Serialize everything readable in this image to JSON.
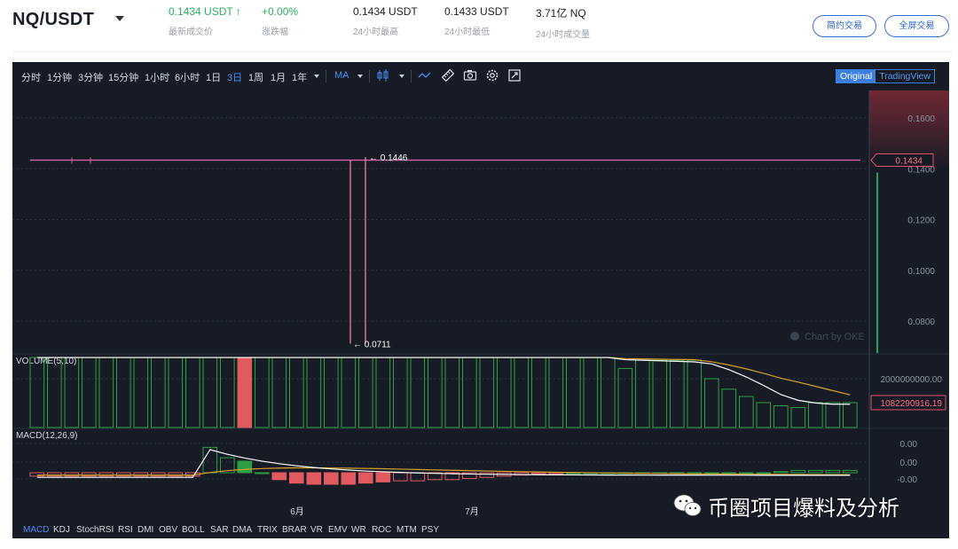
{
  "header": {
    "pair": "NQ/USDT",
    "stats": [
      {
        "value": "0.1434 USDT ↑",
        "label": "最新成交价",
        "color": "green"
      },
      {
        "value": "+0.00%",
        "label": "涨跌幅",
        "color": "green"
      },
      {
        "value": "0.1434 USDT",
        "label": "24小时最高"
      },
      {
        "value": "0.1433 USDT",
        "label": "24小时最低"
      },
      {
        "value": "3.71亿 NQ",
        "label": "24小时成交量"
      }
    ],
    "buttons": {
      "simple": "简约交易",
      "fullscreen": "全屏交易"
    }
  },
  "toolbar": {
    "intervals": [
      "分时",
      "1分钟",
      "3分钟",
      "15分钟",
      "1小时",
      "6小时",
      "1日",
      "3日",
      "1周",
      "1月",
      "1年"
    ],
    "active_interval": "3日",
    "ma_label": "MA",
    "view_original": "Original",
    "view_tradingview": "TradingView",
    "icons": [
      "candle-type-icon",
      "line-draw-icon",
      "ruler-icon",
      "camera-icon",
      "settings-icon",
      "fullscreen-icon"
    ]
  },
  "indicator_tabs": [
    "MACD",
    "KDJ",
    "StochRSI",
    "RSI",
    "DMI",
    "OBV",
    "BOLL",
    "SAR",
    "DMA",
    "TRIX",
    "BRAR",
    "VR",
    "EMV",
    "WR",
    "ROC",
    "MTM",
    "PSY"
  ],
  "active_indicator": "MACD",
  "watermark": {
    "text": "币圈项目爆料及分析",
    "icon": "wechat-icon"
  },
  "chart_data": [
    {
      "type": "line",
      "title": "",
      "y_ticks": [
        "0.1600",
        "0.1400",
        "0.1200",
        "0.1000",
        "0.0800"
      ],
      "ylim": [
        0.0711,
        0.1693
      ],
      "x_ticks": [
        "6月",
        "7月"
      ],
      "last_price_label": "0.1434",
      "high_label": "0.1446",
      "low_label": "0.0711",
      "price_level": 0.1434,
      "spike_high": 0.1446,
      "spike_low": 0.0711,
      "credit": "Chart by OKE"
    },
    {
      "type": "bar",
      "title": "VOLUME(5,10)",
      "y_ticks": [
        "2000000000.00"
      ],
      "last_label": "1082290916.19",
      "values": [
        2870000000,
        2870000000,
        2870000000,
        2870000000,
        2870000000,
        2870000000,
        2870000000,
        2870000000,
        2870000000,
        2870000000,
        2870000000,
        2870000000,
        2870000000,
        2870000000,
        2870000000,
        2870000000,
        2870000000,
        2870000000,
        2870000000,
        2870000000,
        2870000000,
        2870000000,
        2870000000,
        2870000000,
        2870000000,
        2870000000,
        2870000000,
        2870000000,
        2870000000,
        2870000000,
        2870000000,
        2870000000,
        2870000000,
        2870000000,
        2420000000,
        2760000000,
        2760000000,
        2760000000,
        2760000000,
        2000000000,
        1570000000,
        1270000000,
        1020000000,
        890000000,
        820000000,
        1020000000,
        1020000000,
        1020000000
      ]
    },
    {
      "type": "bar",
      "title": "MACD(12,26,9)",
      "y_ticks": [
        "0.00",
        "0.00",
        "-0.00"
      ],
      "histogram": [
        -0.15,
        -0.15,
        -0.15,
        -0.15,
        -0.15,
        -0.15,
        -0.15,
        -0.15,
        -0.15,
        -0.15,
        1.1,
        0.65,
        0.5,
        0,
        -0.3,
        -0.45,
        -0.5,
        -0.5,
        -0.5,
        -0.45,
        -0.4,
        -0.35,
        -0.35,
        -0.3,
        -0.3,
        -0.25,
        -0.2,
        -0.15,
        -0.1,
        -0.05,
        -0.05,
        0,
        0,
        0,
        0,
        0,
        0,
        0,
        0,
        0,
        0,
        0,
        0,
        0.05,
        0.1,
        0.1,
        0.1,
        0.1
      ]
    }
  ]
}
